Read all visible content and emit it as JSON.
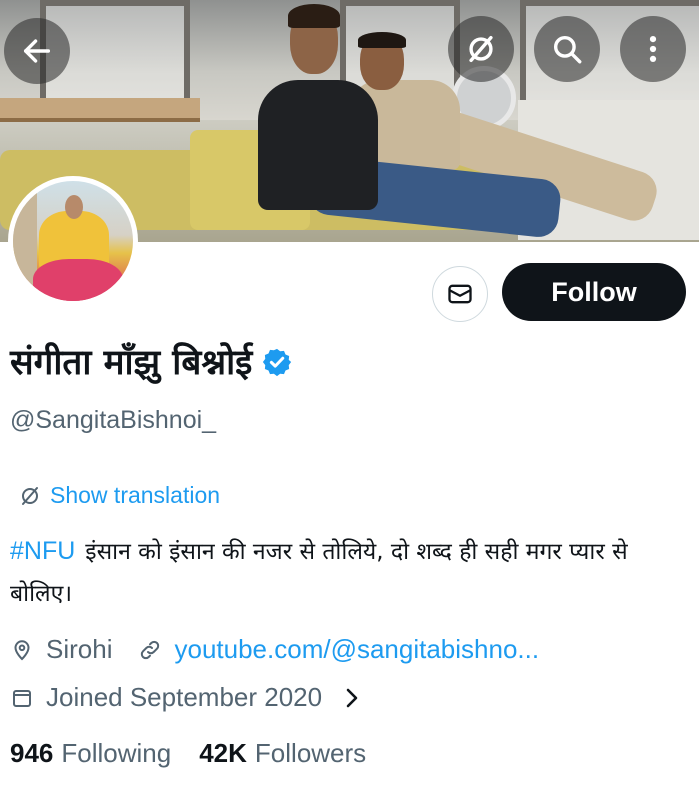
{
  "header": {
    "back_icon": "arrow-left-icon",
    "translate_icon": "translate-icon",
    "search_icon": "search-icon",
    "more_icon": "more-vertical-icon"
  },
  "profile": {
    "display_name": "संगीता माँझु बिश्नोई",
    "verified": true,
    "handle": "@SangitaBishnoi_",
    "follow_label": "Follow",
    "message_icon": "envelope-icon"
  },
  "translation": {
    "label": "Show translation"
  },
  "bio": {
    "hashtag": "#NFU",
    "text": "इंसान को इंसान की नजर से तोलिये, दो शब्द ही सही मगर प्यार से बोलिए।"
  },
  "meta": {
    "location": "Sirohi",
    "website": "youtube.com/@sangitabishno...",
    "joined": "Joined September 2020"
  },
  "stats": {
    "following_count": "946",
    "following_label": "Following",
    "followers_count": "42K",
    "followers_label": "Followers"
  },
  "colors": {
    "accent": "#1d9bf0",
    "text_primary": "#0f1419",
    "text_secondary": "#536471",
    "follow_bg": "#0f1419"
  }
}
